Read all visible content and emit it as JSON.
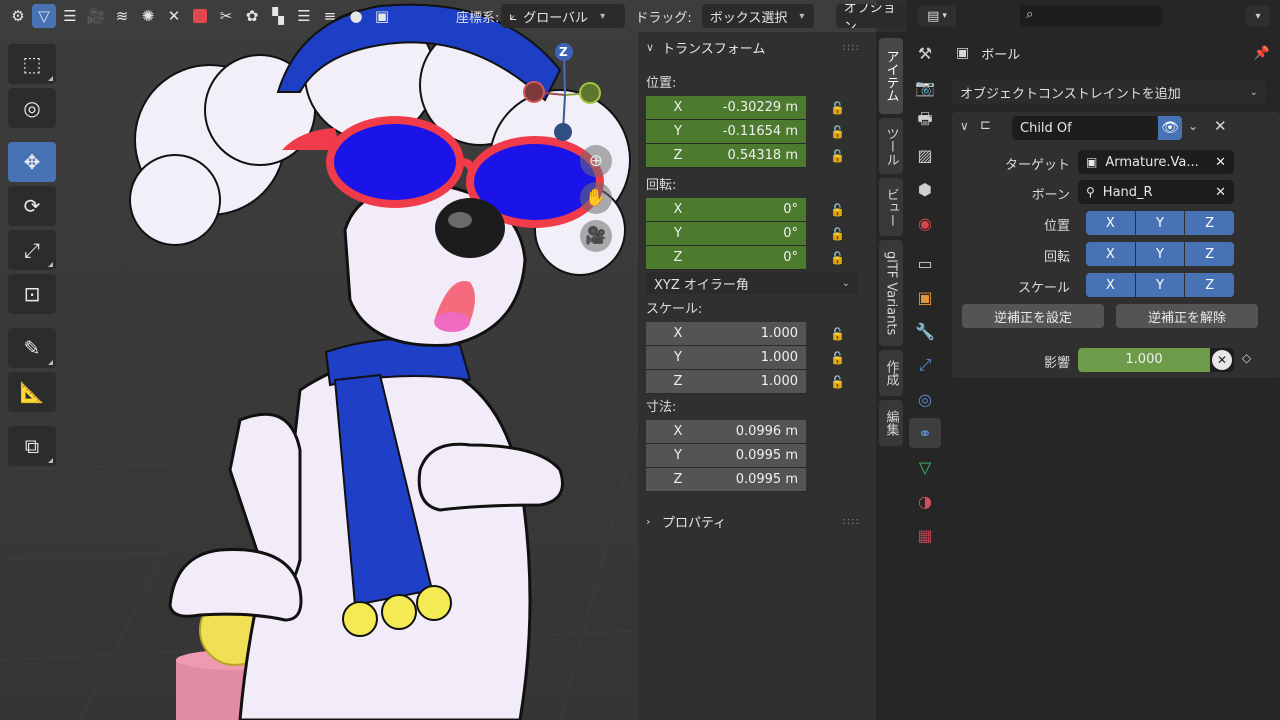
{
  "viewport_header": {
    "orientation_label": "座標系:",
    "orientation_value": "グローバル",
    "drag_label": "ドラッグ:",
    "drag_value": "ボックス選択",
    "options_label": "オプション"
  },
  "gizmo": {
    "z_label": "Z"
  },
  "tools": [
    {
      "name": "select-box",
      "icon": "cursor-select-icon"
    },
    {
      "name": "cursor",
      "icon": "3d-cursor-icon"
    },
    {
      "name": "move",
      "icon": "move-icon"
    },
    {
      "name": "rotate",
      "icon": "rotate-icon"
    },
    {
      "name": "scale",
      "icon": "scale-icon"
    },
    {
      "name": "transform",
      "icon": "transform-icon"
    },
    {
      "name": "annotate",
      "icon": "annotate-icon"
    },
    {
      "name": "measure",
      "icon": "measure-icon"
    },
    {
      "name": "add-cube",
      "icon": "add-cube-icon"
    }
  ],
  "npanel": {
    "transform_title": "トランスフォーム",
    "location_label": "位置:",
    "location": [
      {
        "axis": "X",
        "value": "-0.30229 m"
      },
      {
        "axis": "Y",
        "value": "-0.11654 m"
      },
      {
        "axis": "Z",
        "value": "0.54318 m"
      }
    ],
    "rotation_label": "回転:",
    "rotation": [
      {
        "axis": "X",
        "value": "0°"
      },
      {
        "axis": "Y",
        "value": "0°"
      },
      {
        "axis": "Z",
        "value": "0°"
      }
    ],
    "rotation_mode": "XYZ オイラー角",
    "scale_label": "スケール:",
    "scale": [
      {
        "axis": "X",
        "value": "1.000"
      },
      {
        "axis": "Y",
        "value": "1.000"
      },
      {
        "axis": "Z",
        "value": "1.000"
      }
    ],
    "dimensions_label": "寸法:",
    "dimensions": [
      {
        "axis": "X",
        "value": "0.0996 m"
      },
      {
        "axis": "Y",
        "value": "0.0995 m"
      },
      {
        "axis": "Z",
        "value": "0.0995 m"
      }
    ],
    "properties_title": "プロパティ"
  },
  "vtabs": [
    "アイテム",
    "ツール",
    "ビュー",
    "glTF Variants",
    "作成",
    "編集"
  ],
  "props": {
    "object_name": "ボール",
    "add_constraint": "オブジェクトコンストレイントを追加",
    "constraint": {
      "name": "Child Of",
      "target_label": "ターゲット",
      "target_value": "Armature.Va...",
      "bone_label": "ボーン",
      "bone_value": "Hand_R",
      "location_label": "位置",
      "rotation_label": "回転",
      "scale_label": "スケール",
      "x": "X",
      "y": "Y",
      "z": "Z",
      "set_inverse": "逆補正を設定",
      "clear_inverse": "逆補正を解除",
      "influence_label": "影響",
      "influence_value": "1.000",
      "influence": 1.0
    }
  },
  "colors": {
    "accent_blue": "#4772b3",
    "field_green": "#4c7b2f",
    "influence_green": "#6c9c4a",
    "panel_bg": "#303030"
  }
}
